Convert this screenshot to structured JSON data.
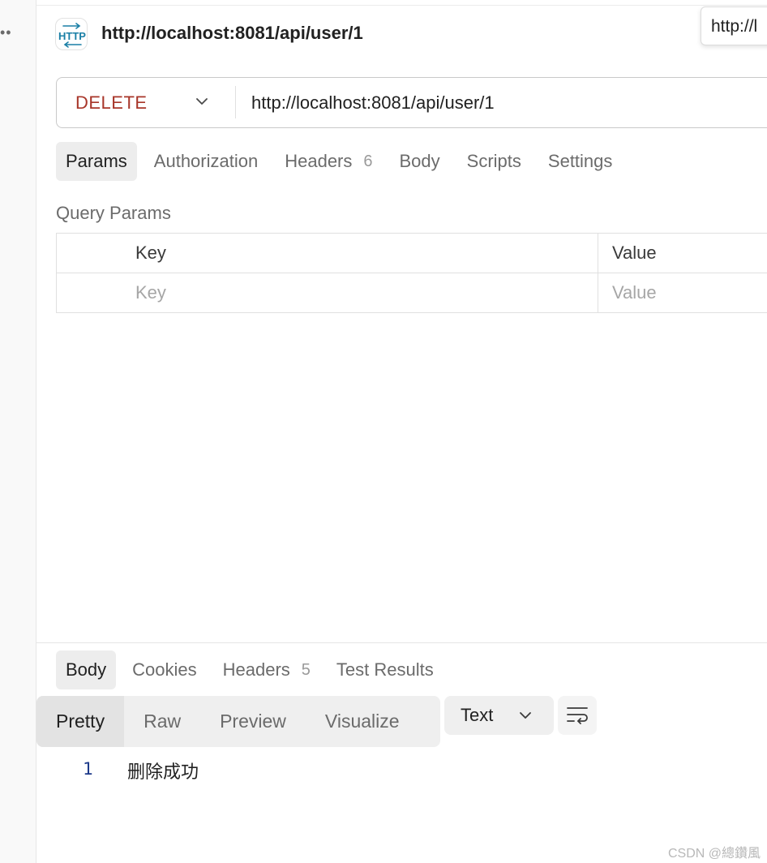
{
  "app": {
    "left_dots": "••"
  },
  "request": {
    "title": "http://localhost:8081/api/user/1",
    "tooltip": "http://l",
    "method": "DELETE",
    "url": "http://localhost:8081/api/user/1"
  },
  "request_tabs": [
    {
      "label": "Params",
      "active": true
    },
    {
      "label": "Authorization"
    },
    {
      "label": "Headers",
      "count": "6"
    },
    {
      "label": "Body"
    },
    {
      "label": "Scripts"
    },
    {
      "label": "Settings"
    }
  ],
  "query_params": {
    "label": "Query Params",
    "columns": [
      "Key",
      "Value"
    ],
    "placeholders": [
      "Key",
      "Value"
    ]
  },
  "response_tabs": [
    {
      "label": "Body",
      "active": true
    },
    {
      "label": "Cookies"
    },
    {
      "label": "Headers",
      "count": "5"
    },
    {
      "label": "Test Results"
    }
  ],
  "response_formats": [
    {
      "label": "Pretty",
      "active": true
    },
    {
      "label": "Raw"
    },
    {
      "label": "Preview"
    },
    {
      "label": "Visualize"
    }
  ],
  "response_type": "Text",
  "response_body": [
    {
      "line": "1",
      "text": "删除成功"
    }
  ],
  "watermark": "CSDN @總鑽風",
  "colors": {
    "method": "#a8362a",
    "line_number": "#1d3a8a",
    "http_icon": "#1a7fa6"
  },
  "icons": [
    "http-icon",
    "chevron-down-icon",
    "wrap-text-icon"
  ]
}
